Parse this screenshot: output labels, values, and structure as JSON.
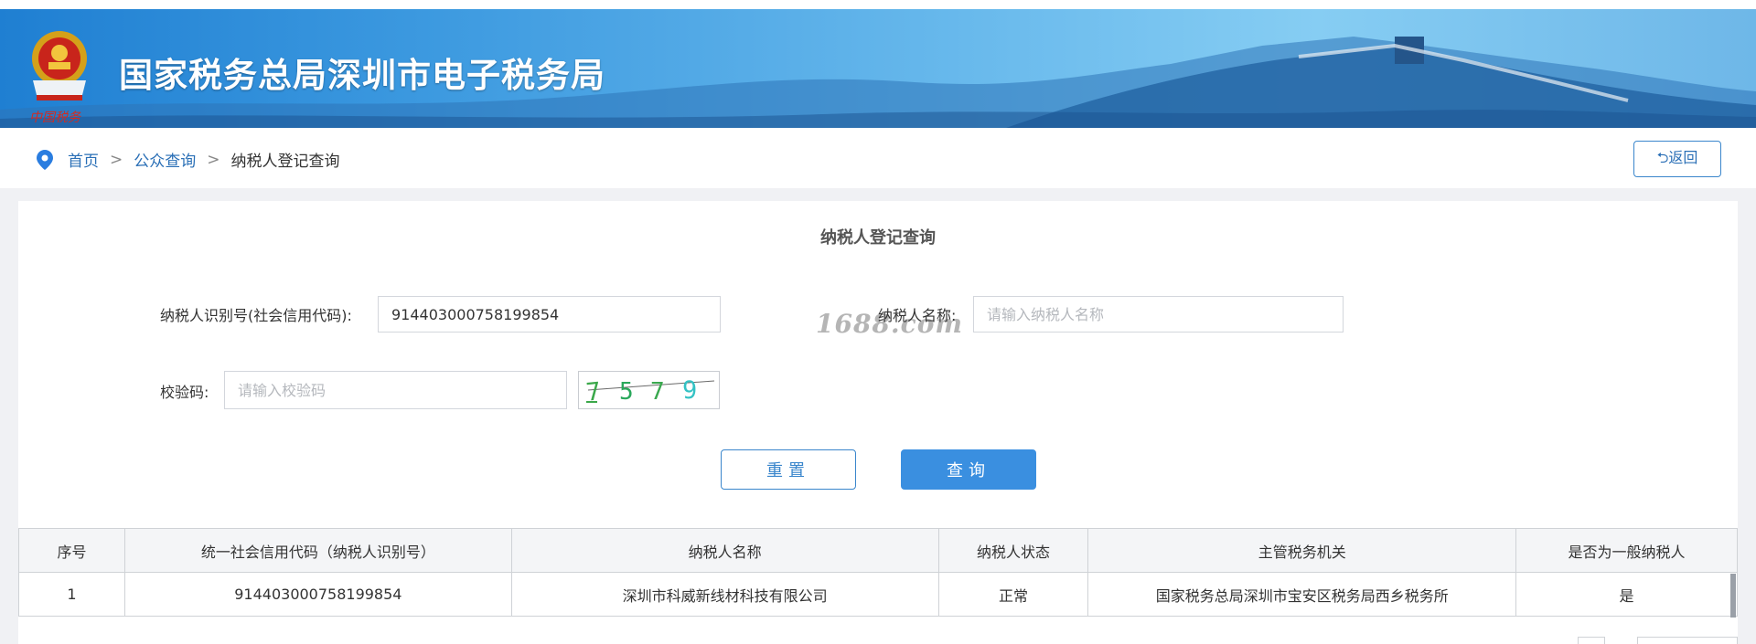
{
  "header": {
    "site_title": "国家税务总局深圳市电子税务局",
    "emblem_caption": "中国税务"
  },
  "breadcrumb": {
    "home": "首页",
    "sep": ">",
    "public_query": "公众查询",
    "current": "纳税人登记查询"
  },
  "back_button": {
    "label": "⮌返回"
  },
  "form": {
    "title": "纳税人登记查询",
    "id_label": "纳税人识别号(社会信用代码):",
    "id_value": "914403000758199854",
    "name_label": "纳税人名称:",
    "name_placeholder": "请输入纳税人名称",
    "code_label": "校验码:",
    "code_placeholder": "请输入校验码",
    "captcha_chars": [
      "7",
      "5",
      "7",
      "9"
    ],
    "reset_label": "重置",
    "query_label": "查询",
    "watermark": "1688.com"
  },
  "table": {
    "columns": [
      "序号",
      "统一社会信用代码（纳税人识别号）",
      "纳税人名称",
      "纳税人状态",
      "主管税务机关",
      "是否为一般纳税人"
    ],
    "rows": [
      [
        "1",
        "914403000758199854",
        "深圳市科威新线材科技有限公司",
        "正常",
        "国家税务总局深圳市宝安区税务局西乡税务所",
        "是"
      ]
    ]
  },
  "colors": {
    "accent": "#3a8fe0",
    "link": "#2a6fb6",
    "banner": "#3d9ae0"
  }
}
